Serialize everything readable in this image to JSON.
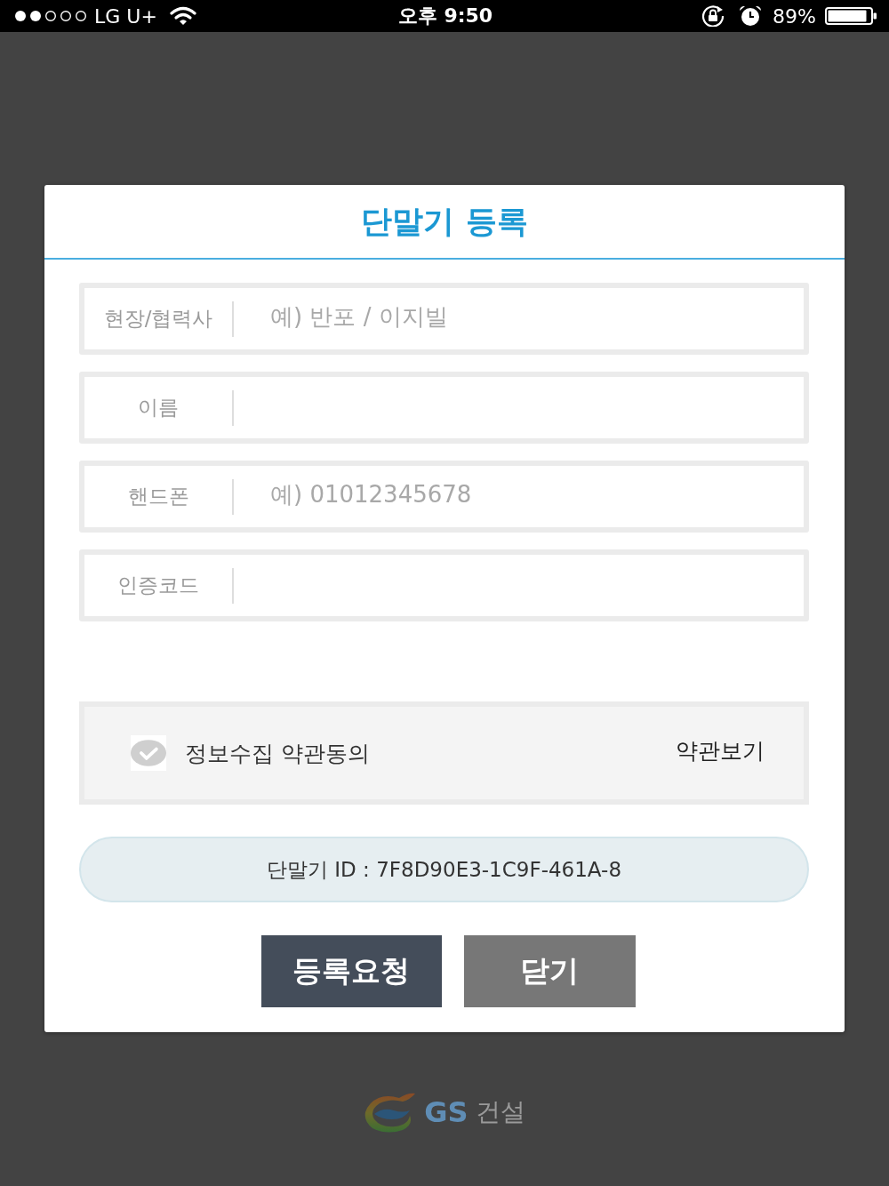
{
  "status_bar": {
    "carrier": "LG U+",
    "time": "오후 9:50",
    "battery": "89%"
  },
  "dialog": {
    "title": "단말기 등록",
    "fields": [
      {
        "label": "현장/협력사",
        "placeholder": "예) 반포 / 이지빌"
      },
      {
        "label": "이름"
      },
      {
        "label": "핸드폰",
        "placeholder": "예) 01012345678"
      },
      {
        "label": "인증코드"
      }
    ],
    "agreement": {
      "label": "정보수집 약관동의",
      "checked": false,
      "link": "약관보기"
    },
    "device_id": "단말기 ID : 7F8D90E3-1C9F-461A-8",
    "buttons": [
      {
        "label": "등록요청",
        "kind": "primary"
      },
      {
        "label": "닫기",
        "kind": "secondary"
      }
    ]
  },
  "logo": {
    "brand": "GS",
    "suffix": "건설"
  }
}
